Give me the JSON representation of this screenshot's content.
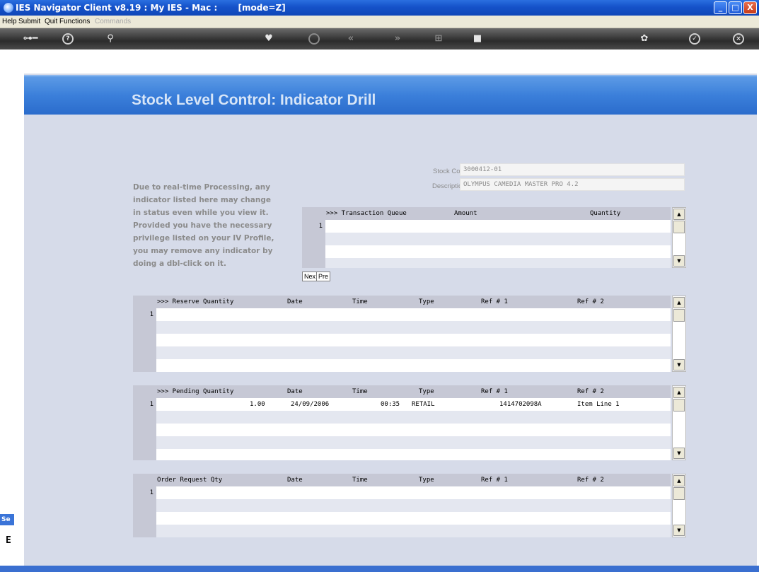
{
  "window": {
    "title": "IES Navigator Client v8.19 : My IES - Mac :       [mode=Z]",
    "controls": {
      "minimize": "_",
      "maximize": "□",
      "close": "X"
    }
  },
  "menu": {
    "items": [
      "Help",
      "Submit",
      "Quit",
      "Functions"
    ],
    "disabled_item": "Commands"
  },
  "toolbar": {
    "icons": [
      "key-icon",
      "help-icon",
      "search-icon",
      "heart-icon",
      "clock-icon",
      "rewind-icon",
      "forward-icon",
      "tree-icon",
      "stop-icon",
      "settings-icon",
      "check-icon",
      "close-icon"
    ]
  },
  "page": {
    "heading": "Stock Level Control: Indicator Drill",
    "info_lines": [
      "Due to real-time Processing, any",
      "indicator listed here may change",
      "in status even while you view it.",
      "Provided you have the necessary",
      "privilege listed on your IV Profile,",
      "you may remove any indicator by",
      "doing a dbl-click on it."
    ],
    "side_tab": "Se",
    "side_box": "E"
  },
  "stock": {
    "code_label": "Stock Code",
    "code_value": "3000412-01",
    "desc_label": "Description",
    "desc_value": "OLYMPUS CAMEDIA MASTER PRO 4.2"
  },
  "transaction_queue": {
    "headers": [
      ">>> Transaction Queue",
      "Amount",
      "Quantity"
    ],
    "row_number": "1",
    "next_label": "Nex",
    "prev_label": "Pre"
  },
  "reserve": {
    "headers": [
      ">>> Reserve Quantity",
      "Date",
      "Time",
      "Type",
      "Ref # 1",
      "Ref # 2"
    ],
    "row_number": "1"
  },
  "pending": {
    "headers": [
      ">>> Pending Quantity",
      "Date",
      "Time",
      "Type",
      "Ref # 1",
      "Ref # 2"
    ],
    "row_number": "1",
    "row": {
      "qty": "1.00",
      "date": "24/09/2006",
      "time": "00:35",
      "type": "RETAIL",
      "ref1": "1414702098A",
      "ref2": "Item Line 1"
    }
  },
  "order_request": {
    "headers": [
      "Order Request Qty",
      "Date",
      "Time",
      "Type",
      "Ref # 1",
      "Ref # 2"
    ],
    "row_number": "1"
  },
  "scroll": {
    "up": "▲",
    "down": "▼"
  }
}
